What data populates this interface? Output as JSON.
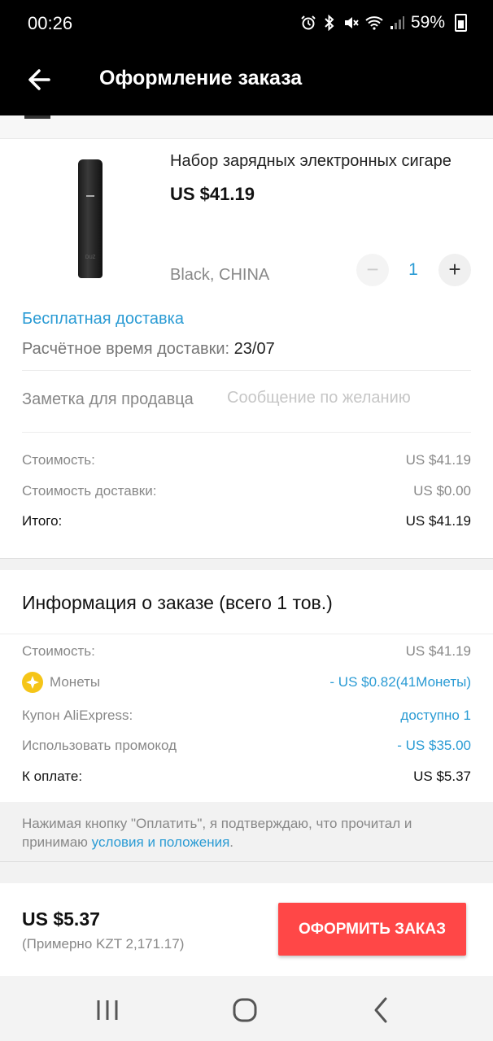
{
  "status_bar": {
    "time": "00:26",
    "battery": "59%",
    "icons": [
      "alarm-icon",
      "bluetooth-icon",
      "mute-icon",
      "wifi-icon",
      "signal-icon",
      "battery-icon"
    ]
  },
  "app_bar": {
    "title": "Оформление заказа"
  },
  "product": {
    "name": "Набор зарядных электронных сигаре",
    "price": "US $41.19",
    "variant": "Black, CHINA",
    "quantity": "1",
    "image_logo_text": "DUZ"
  },
  "shipping": {
    "free_label": "Бесплатная доставка",
    "eta_label": "Расчётное время доставки:",
    "eta_date": "23/07"
  },
  "seller_note": {
    "label": "Заметка для продавца",
    "placeholder": "Сообщение по желанию",
    "value": ""
  },
  "store_summary": {
    "cost_label": "Стоимость:",
    "cost_value": "US $41.19",
    "shipping_label": "Стоимость доставки:",
    "shipping_value": "US $0.00",
    "total_label": "Итого:",
    "total_value": "US $41.19"
  },
  "order_info": {
    "title": "Информация о заказе (всего 1 тов.)",
    "cost_label": "Стоимость:",
    "cost_value": "US $41.19",
    "coins_label": "Монеты",
    "coins_value": "- US $0.82(41Монеты)",
    "coupon_label": "Купон AliExpress:",
    "coupon_value": "доступно 1",
    "promo_label": "Использовать промокод",
    "promo_value": "- US $35.00",
    "pay_label": "К оплате:",
    "pay_value": "US $5.37"
  },
  "terms": {
    "text": "Нажимая кнопку \"Оплатить\", я подтверждаю, что прочитал и принимаю ",
    "link": "условия и положения",
    "end": "."
  },
  "footer": {
    "total": "US $5.37",
    "approx": "(Примерно KZT 2,171.17)",
    "order_button": "ОФОРМИТЬ ЗАКАЗ"
  },
  "colors": {
    "accent_blue": "#2a9bd4",
    "order_button": "#ff4747",
    "coin": "#f5c518"
  }
}
